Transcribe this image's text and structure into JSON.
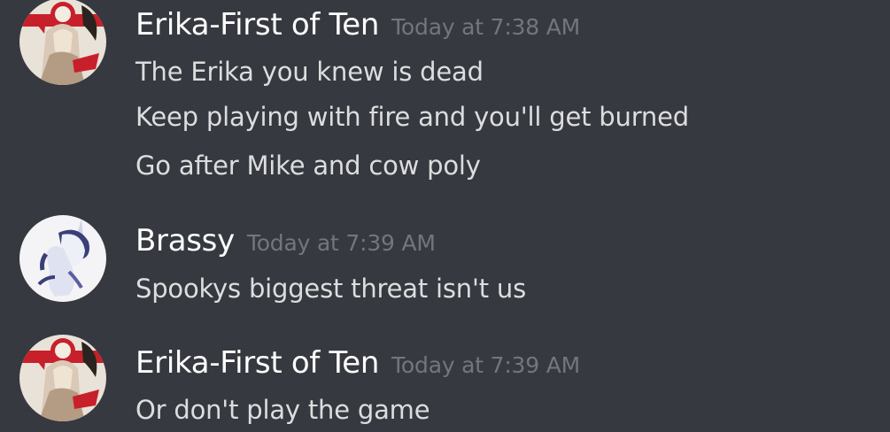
{
  "messages": [
    {
      "author": "Erika-First of Ten",
      "timestamp": "Today at 7:38 AM",
      "lines": [
        "The Erika you knew is dead",
        "Keep playing with fire and you'll get burned",
        "Go after Mike and cow poly"
      ]
    },
    {
      "author": "Brassy",
      "timestamp": "Today at 7:39 AM",
      "lines": [
        "Spookys biggest threat isn't us"
      ]
    },
    {
      "author": "Erika-First of Ten",
      "timestamp": "Today at 7:39 AM",
      "lines": [
        "Or don't play the game"
      ]
    }
  ],
  "colors": {
    "background": "#36393f",
    "username": "#ffffff",
    "timestamp": "#72767d",
    "message_text": "#dcddde"
  }
}
